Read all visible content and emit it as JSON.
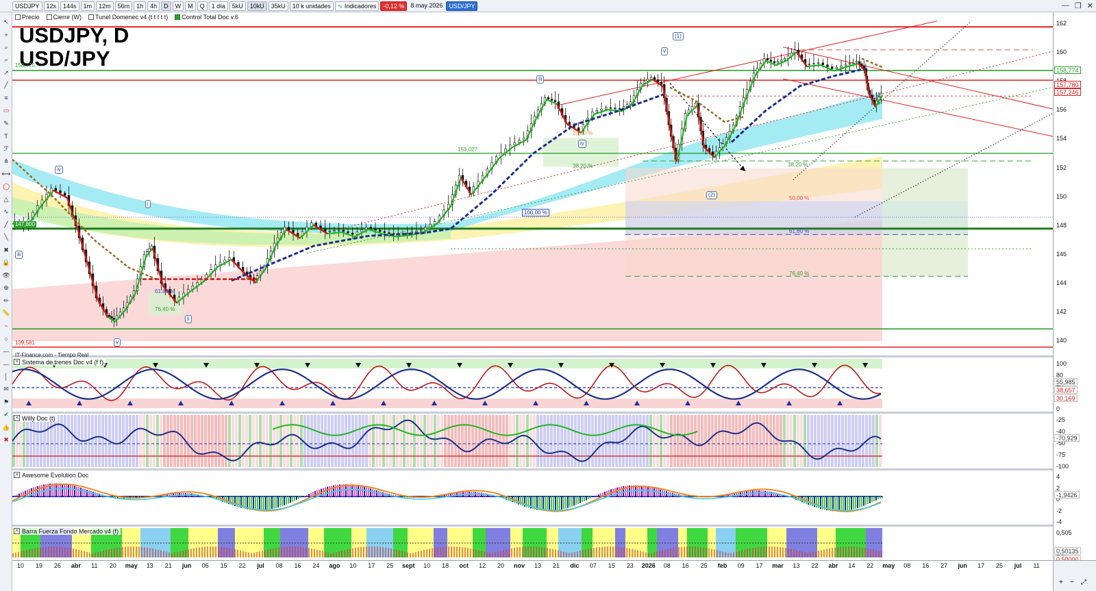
{
  "toolbar": {
    "symbol": "USDJPY",
    "intervals": [
      "12s",
      "144s",
      "1m",
      "12m",
      "56m",
      "1h",
      "4h",
      "D",
      "W",
      "M",
      "Q"
    ],
    "selected_interval": "D",
    "period": "1 día",
    "ranges": [
      "5kU",
      "10kU",
      "35kU"
    ],
    "units": "10 k unidades",
    "indicators_label": "Indicadores",
    "change_pct": "-0,12 %",
    "date": "8 may 2026",
    "symbol_badge": "USD/JPY"
  },
  "overlays": [
    {
      "label": "Precio",
      "checked": false
    },
    {
      "label": "Cierre (W)",
      "checked": false
    },
    {
      "label": "Tunel Domenec v4 (t t t t t)",
      "checked": false
    },
    {
      "label": "Control Total Doc v.6",
      "checked": true
    }
  ],
  "chart": {
    "title": "USDJPY, D",
    "subtitle": "USD/JPY",
    "source": "IT-Finance.com - Tiempo Real",
    "price_ticks": [
      "162",
      "160",
      "158",
      "156",
      "154",
      "152",
      "150",
      "148",
      "146",
      "144",
      "142",
      "140"
    ],
    "price_tags": [
      {
        "text": "158,774",
        "color": "#2ca02c"
      },
      {
        "text": "157,780",
        "color": "#e02020"
      },
      {
        "text": "157,246",
        "color": "#e02020"
      }
    ],
    "level_labels": [
      {
        "text": "158,775",
        "color": "#2ca02c"
      },
      {
        "text": "153,027",
        "color": "#2ca02c"
      },
      {
        "text": "147,800",
        "color": "#2ca02c"
      },
      {
        "text": "139,581",
        "color": "#e02020"
      }
    ],
    "fib_labels": [
      "23,60 %",
      "38,20 %",
      "38,20 %",
      "50,00 %",
      "61,80 %",
      "76,40 %",
      "61,80 %",
      "76,40 %",
      "100,00 %"
    ],
    "wave_labels": [
      "iv",
      "i",
      "ii",
      "iii",
      "v",
      "iii",
      "iv",
      "v",
      "(1)",
      "(2)"
    ]
  },
  "panels": [
    {
      "name": "Sistema de trenes Doc v4 (f f)",
      "ticks": [
        "100",
        "80",
        "50",
        "20",
        "0"
      ],
      "tags": [
        "55,985",
        "38,657",
        "30,169"
      ]
    },
    {
      "name": "Willy Doc (t)",
      "ticks": [
        "-25",
        "-40",
        "-50",
        "-75",
        "-100"
      ],
      "tags": [
        "-70,929"
      ]
    },
    {
      "name": "Awesome Evolution Doc",
      "ticks": [
        "4",
        "2",
        "0",
        "-2",
        "-4"
      ],
      "tags": [
        "-1,9426"
      ]
    },
    {
      "name": "Barra Fuerza Fondo Mercado v4 (f)",
      "ticks": [
        "0,505",
        "0,5"
      ],
      "tags": [
        "0,50135",
        "0,50000"
      ]
    }
  ],
  "date_axis": [
    {
      "t": "10",
      "b": false
    },
    {
      "t": "19",
      "b": false
    },
    {
      "t": "26",
      "b": false
    },
    {
      "t": "abr",
      "b": true
    },
    {
      "t": "11",
      "b": false
    },
    {
      "t": "20",
      "b": false
    },
    {
      "t": "may",
      "b": true
    },
    {
      "t": "13",
      "b": false
    },
    {
      "t": "21",
      "b": false
    },
    {
      "t": "jun",
      "b": true
    },
    {
      "t": "06",
      "b": false
    },
    {
      "t": "15",
      "b": false
    },
    {
      "t": "22",
      "b": false
    },
    {
      "t": "jul",
      "b": true
    },
    {
      "t": "08",
      "b": false
    },
    {
      "t": "16",
      "b": false
    },
    {
      "t": "24",
      "b": false
    },
    {
      "t": "ago",
      "b": true
    },
    {
      "t": "10",
      "b": false
    },
    {
      "t": "17",
      "b": false
    },
    {
      "t": "25",
      "b": false
    },
    {
      "t": "sept",
      "b": true
    },
    {
      "t": "10",
      "b": false
    },
    {
      "t": "18",
      "b": false
    },
    {
      "t": "oct",
      "b": true
    },
    {
      "t": "12",
      "b": false
    },
    {
      "t": "20",
      "b": false
    },
    {
      "t": "nov",
      "b": true
    },
    {
      "t": "13",
      "b": false
    },
    {
      "t": "21",
      "b": false
    },
    {
      "t": "dic",
      "b": true
    },
    {
      "t": "07",
      "b": false
    },
    {
      "t": "15",
      "b": false
    },
    {
      "t": "23",
      "b": false
    },
    {
      "t": "2026",
      "b": true
    },
    {
      "t": "08",
      "b": false
    },
    {
      "t": "16",
      "b": false
    },
    {
      "t": "25",
      "b": false
    },
    {
      "t": "feb",
      "b": true
    },
    {
      "t": "09",
      "b": false
    },
    {
      "t": "17",
      "b": false
    },
    {
      "t": "mar",
      "b": true
    },
    {
      "t": "13",
      "b": false
    },
    {
      "t": "22",
      "b": false
    },
    {
      "t": "abr",
      "b": true
    },
    {
      "t": "14",
      "b": false
    },
    {
      "t": "22",
      "b": false
    },
    {
      "t": "may",
      "b": true
    },
    {
      "t": "08",
      "b": false
    },
    {
      "t": "16",
      "b": false
    },
    {
      "t": "27",
      "b": false
    },
    {
      "t": "jun",
      "b": true
    },
    {
      "t": "17",
      "b": false
    },
    {
      "t": "25",
      "b": false
    },
    {
      "t": "jul",
      "b": true
    },
    {
      "t": "11",
      "b": false
    }
  ],
  "colors": {
    "resistance": "#e02020",
    "support": "#1f9a1f",
    "trend_up": "#22b422",
    "trend_down": "#d01818",
    "cloud_cyan": "#7fe3ef",
    "cloud_yellow": "#fff3a0",
    "cloud_pink": "#f9c9c9"
  }
}
